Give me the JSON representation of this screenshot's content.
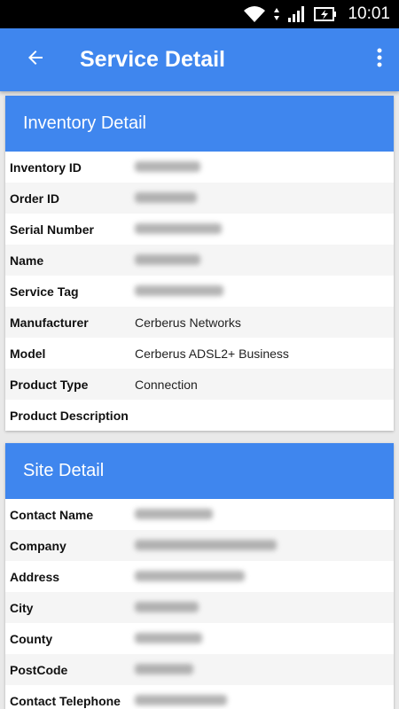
{
  "status_bar": {
    "time": "10:01",
    "icons": [
      "wifi-icon",
      "signal-icon",
      "battery-charging-icon"
    ]
  },
  "app_bar": {
    "title": "Service Detail",
    "back_icon": "arrow-left-icon",
    "more_icon": "more-vert-icon"
  },
  "inventory": {
    "header": "Inventory Detail",
    "rows": [
      {
        "label": "Inventory ID",
        "value": "",
        "blurred": true
      },
      {
        "label": "Order ID",
        "value": "",
        "blurred": true
      },
      {
        "label": "Serial Number",
        "value": "",
        "blurred": true
      },
      {
        "label": "Name",
        "value": "",
        "blurred": true
      },
      {
        "label": "Service Tag",
        "value": "",
        "blurred": true
      },
      {
        "label": "Manufacturer",
        "value": "Cerberus Networks",
        "blurred": false
      },
      {
        "label": "Model",
        "value": "Cerberus ADSL2+ Business",
        "blurred": false
      },
      {
        "label": "Product Type",
        "value": "Connection",
        "blurred": false
      },
      {
        "label": "Product Description",
        "value": "",
        "blurred": false
      }
    ]
  },
  "site": {
    "header": "Site Detail",
    "rows": [
      {
        "label": "Contact Name",
        "value": "",
        "blurred": true
      },
      {
        "label": "Company",
        "value": "",
        "blurred": true
      },
      {
        "label": "Address",
        "value": "",
        "blurred": true
      },
      {
        "label": "City",
        "value": "",
        "blurred": true
      },
      {
        "label": "County",
        "value": "",
        "blurred": true
      },
      {
        "label": "PostCode",
        "value": "",
        "blurred": true
      },
      {
        "label": "Contact Telephone",
        "value": "",
        "blurred": true
      }
    ]
  },
  "colors": {
    "accent": "#3f86ee",
    "status_bar": "#000000"
  }
}
